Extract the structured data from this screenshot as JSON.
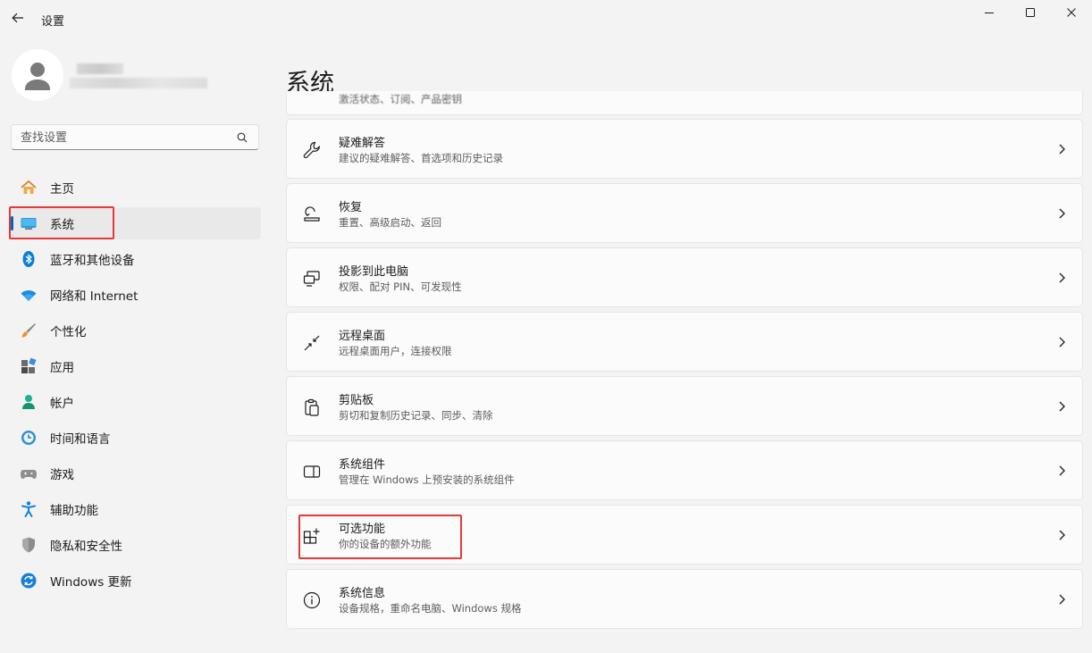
{
  "window": {
    "app_title": "设置",
    "icons": {
      "back": "back-arrow-icon",
      "minimize": "minimize-icon",
      "maximize": "maximize-icon",
      "close": "close-icon"
    }
  },
  "account": {
    "avatar_icon": "user-avatar-icon"
  },
  "search": {
    "placeholder": "查找设置",
    "icon": "search-icon"
  },
  "sidebar": {
    "items": [
      {
        "label": "主页",
        "icon": "home-icon",
        "selected": false
      },
      {
        "label": "系统",
        "icon": "system-display-icon",
        "selected": true
      },
      {
        "label": "蓝牙和其他设备",
        "icon": "bluetooth-icon",
        "selected": false
      },
      {
        "label": "网络和 Internet",
        "icon": "wifi-icon",
        "selected": false
      },
      {
        "label": "个性化",
        "icon": "brush-icon",
        "selected": false
      },
      {
        "label": "应用",
        "icon": "apps-icon",
        "selected": false
      },
      {
        "label": "帐户",
        "icon": "account-icon",
        "selected": false
      },
      {
        "label": "时间和语言",
        "icon": "time-language-icon",
        "selected": false
      },
      {
        "label": "游戏",
        "icon": "gamepad-icon",
        "selected": false
      },
      {
        "label": "辅助功能",
        "icon": "accessibility-icon",
        "selected": false
      },
      {
        "label": "隐私和安全性",
        "icon": "shield-icon",
        "selected": false
      },
      {
        "label": "Windows 更新",
        "icon": "windows-update-icon",
        "selected": false
      }
    ]
  },
  "main": {
    "title": "系统",
    "partial_card": {
      "subtitle": "激活状态、订阅、产品密钥"
    },
    "cards": [
      {
        "title": "疑难解答",
        "subtitle": "建议的疑难解答、首选项和历史记录",
        "icon": "wrench-icon"
      },
      {
        "title": "恢复",
        "subtitle": "重置、高级启动、返回",
        "icon": "recovery-icon"
      },
      {
        "title": "投影到此电脑",
        "subtitle": "权限、配对 PIN、可发现性",
        "icon": "project-to-pc-icon"
      },
      {
        "title": "远程桌面",
        "subtitle": "远程桌面用户，连接权限",
        "icon": "remote-desktop-icon"
      },
      {
        "title": "剪贴板",
        "subtitle": "剪切和复制历史记录、同步、清除",
        "icon": "clipboard-icon"
      },
      {
        "title": "系统组件",
        "subtitle": "管理在 Windows 上预安装的系统组件",
        "icon": "system-components-icon"
      },
      {
        "title": "可选功能",
        "subtitle": "你的设备的额外功能",
        "icon": "optional-features-icon"
      },
      {
        "title": "系统信息",
        "subtitle": "设备规格，重命名电脑、Windows 规格",
        "icon": "info-icon"
      }
    ]
  },
  "colors": {
    "accent": "#0067c0",
    "highlight_box": "#e53935",
    "background": "#f3f3f3",
    "card": "#fbfbfb"
  }
}
